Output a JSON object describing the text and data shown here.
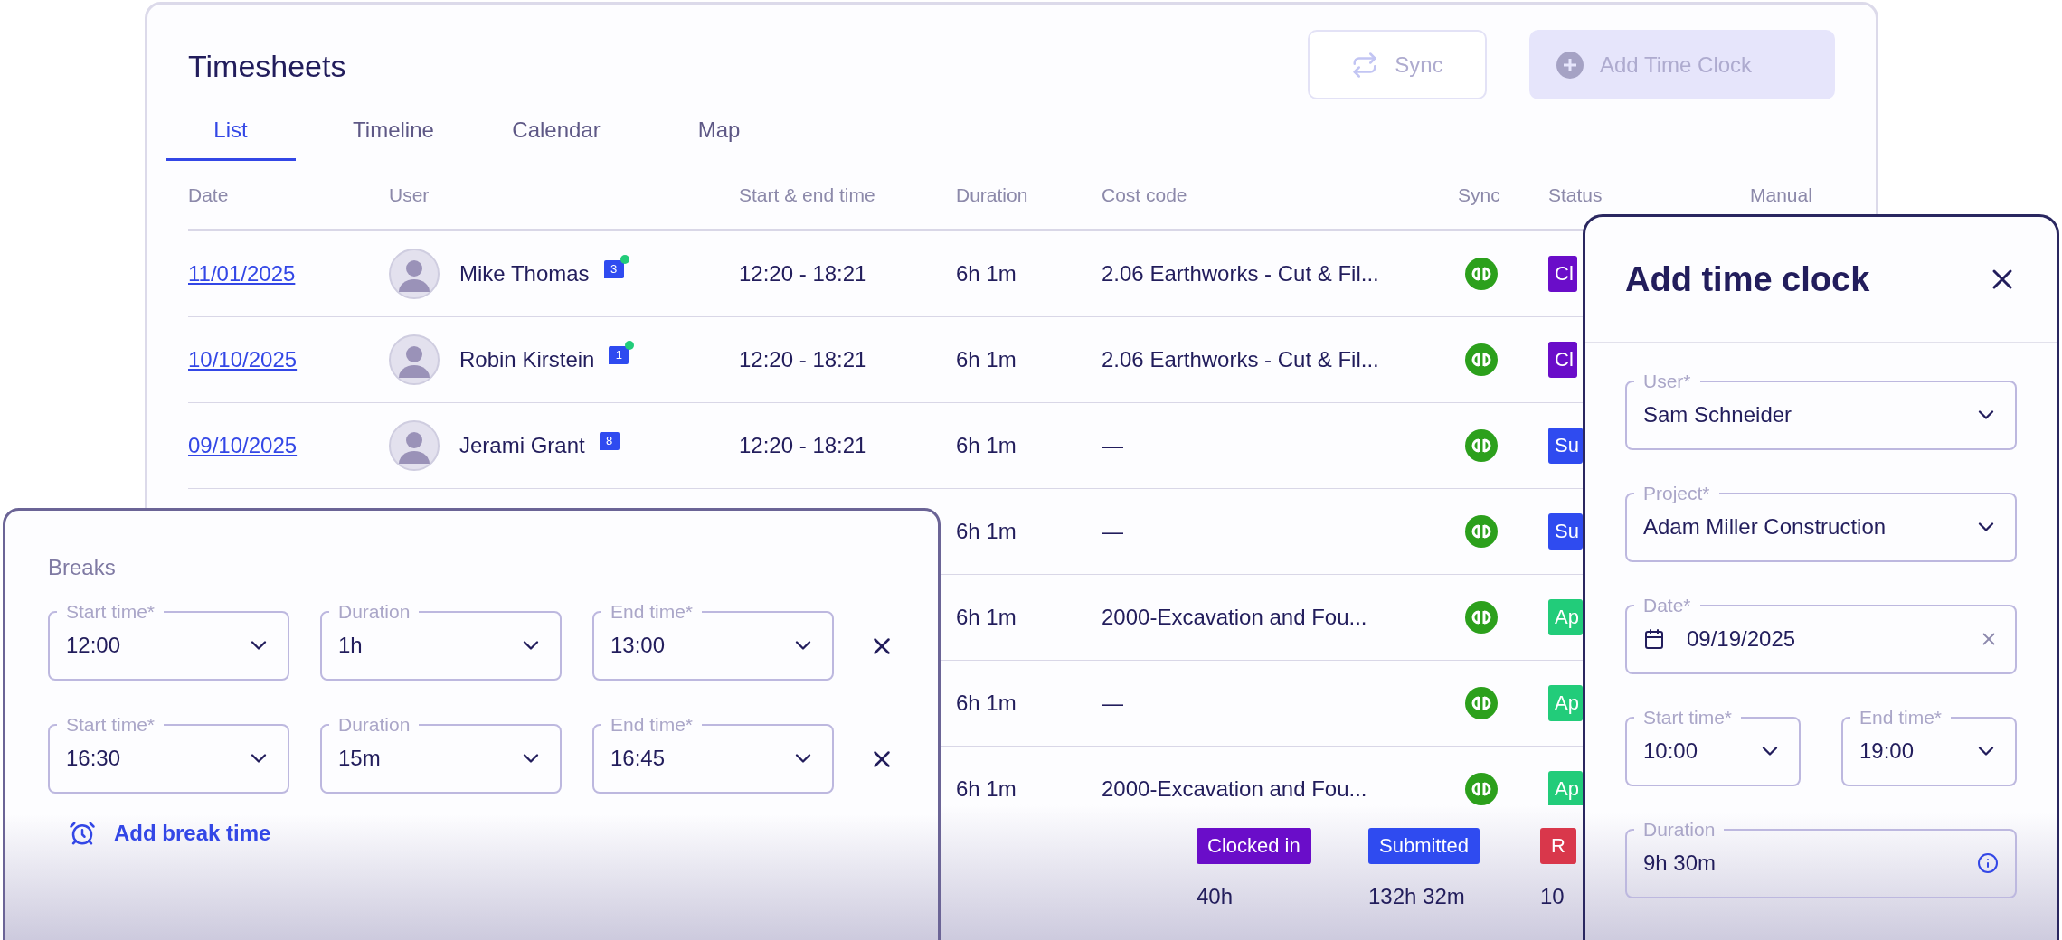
{
  "timesheets": {
    "title": "Timesheets",
    "buttons": [
      {
        "label": "Sync",
        "kind": "sync",
        "disabled": true
      },
      {
        "label": "Add Time Clock",
        "kind": "add",
        "disabled": true
      }
    ],
    "tabs": [
      {
        "label": "List",
        "selected": true
      },
      {
        "label": "Timeline",
        "selected": false
      },
      {
        "label": "Calendar",
        "selected": false
      },
      {
        "label": "Map",
        "selected": false
      }
    ],
    "table": {
      "columns": [
        "Date",
        "User",
        "Start & end time",
        "Duration",
        "Cost code",
        "Sync",
        "Status",
        "Manual"
      ],
      "rows": [
        {
          "date": "11/01/2025",
          "user": "Mike Thomas",
          "comments": "3",
          "unread": true,
          "time": "12:20 - 18:21",
          "duration": "6h 1m",
          "cost_code": "2.06 Earthworks - Cut & Fil...",
          "status": {
            "label": "Cl",
            "color": "#6a0dc9"
          }
        },
        {
          "date": "10/10/2025",
          "user": "Robin Kirstein",
          "comments": "1",
          "unread": true,
          "time": "12:20 - 18:21",
          "duration": "6h 1m",
          "cost_code": "2.06 Earthworks - Cut & Fil...",
          "status": {
            "label": "Cl",
            "color": "#6a0dc9"
          }
        },
        {
          "date": "09/10/2025",
          "user": "Jerami Grant",
          "comments": "8",
          "unread": false,
          "time": "12:20 - 18:21",
          "duration": "6h 1m",
          "cost_code": "—",
          "status": {
            "label": "Su",
            "color": "#2f4bf0"
          }
        },
        {
          "duration": "6h 1m",
          "cost_code": "—",
          "status": {
            "label": "Su",
            "color": "#2f4bf0"
          }
        },
        {
          "duration": "6h 1m",
          "cost_code": "2000-Excavation and Fou...",
          "status": {
            "label": "Ap",
            "color": "#22cc7a"
          }
        },
        {
          "duration": "6h 1m",
          "cost_code": "—",
          "status": {
            "label": "Ap",
            "color": "#22cc7a"
          }
        },
        {
          "duration": "6h 1m",
          "cost_code": "2000-Excavation and Fou...",
          "status": {
            "label": "Ap",
            "color": "#22cc7a"
          }
        }
      ]
    },
    "summary": [
      {
        "label": "Clocked in",
        "color": "#6a0dc9",
        "value": "40h"
      },
      {
        "label": "Submitted",
        "color": "#2f4bf0",
        "value": "132h 32m"
      },
      {
        "label": "R",
        "color": "#d9374b",
        "value": "10"
      }
    ]
  },
  "breaks": {
    "title": "Breaks",
    "rows": [
      [
        {
          "label": "Start time*",
          "value": "12:00"
        },
        {
          "label": "Duration",
          "value": "1h"
        },
        {
          "label": "End time*",
          "value": "13:00"
        }
      ],
      [
        {
          "label": "Start time*",
          "value": "16:30"
        },
        {
          "label": "Duration",
          "value": "15m"
        },
        {
          "label": "End time*",
          "value": "16:45"
        }
      ]
    ],
    "add_link": "Add break time"
  },
  "add_time_clock": {
    "title": "Add time clock",
    "field_rows": [
      [
        {
          "label": "User*",
          "value": "Sam Schneider",
          "kind": "select"
        }
      ],
      [
        {
          "label": "Project*",
          "value": "Adam Miller Construction",
          "kind": "select"
        }
      ],
      [
        {
          "label": "Date*",
          "value": "09/19/2025",
          "kind": "date"
        }
      ],
      [
        {
          "label": "Start time*",
          "value": "10:00",
          "kind": "select"
        },
        {
          "label": "End time*",
          "value": "19:00",
          "kind": "select"
        }
      ],
      [
        {
          "label": "Duration",
          "value": "9h 30m",
          "kind": "info"
        }
      ]
    ]
  }
}
